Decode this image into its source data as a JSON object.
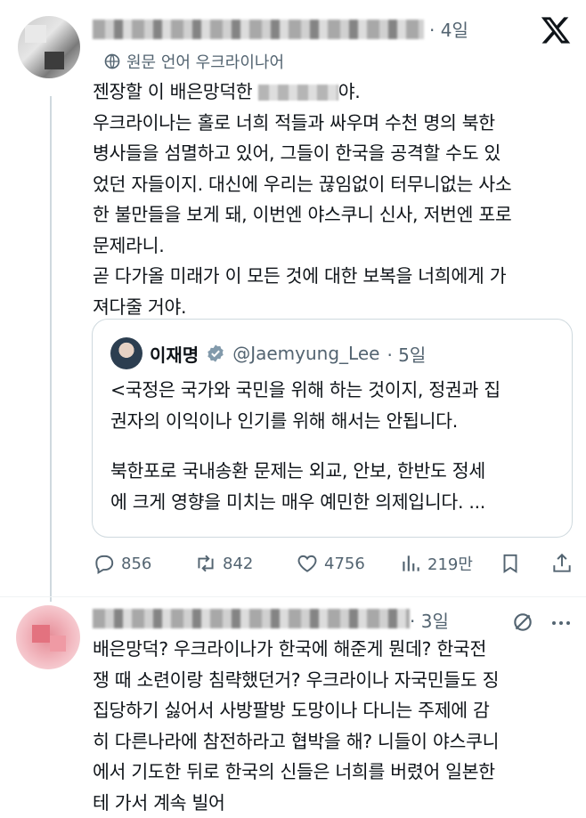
{
  "tweet1": {
    "time": "· 4일",
    "translate_label": "원문 언어 우크라이나어",
    "lines": [
      "젠장할 이 배은망덕한",
      "야.",
      "우크라이나는 홀로 너희 적들과 싸우며 수천 명의 북한",
      "병사들을 섬멸하고 있어, 그들이 한국을 공격할 수도 있",
      "었던 자들이지. 대신에 우리는 끊임없이 터무니없는 사소",
      "한 불만들을 보게 돼, 이번엔 야스쿠니 신사, 저번엔 포로",
      "문제라니.",
      "곧 다가올 미래가 이 모든 것에 대한 보복을 너희에게 가",
      "져다줄 거야."
    ],
    "quote": {
      "name": "이재명",
      "handle": "@Jaemyung_Lee",
      "time": "· 5일",
      "lines": [
        "<국정은 국가와 국민을 위해 하는 것이지, 정권과 집",
        "권자의 이익이나 인기를 위해 해서는 안됩니다.",
        "북한포로 국내송환 문제는 외교, 안보, 한반도 정세",
        "에 크게 영향을 미치는 매우 예민한 의제입니다. ..."
      ]
    },
    "actions": {
      "replies": "856",
      "retweets": "842",
      "likes": "4756",
      "views": "219만"
    }
  },
  "tweet2": {
    "time": "· 3일",
    "lines": [
      "배은망덕? 우크라이나가 한국에 해준게 뭔데? 한국전",
      "쟁 때 소련이랑 침략했던거? 우크라이나 자국민들도 징",
      "집당하기 싫어서 사방팔방 도망이나 다니는 주제에 감",
      "히 다른나라에 참전하라고 협박을 해? 니들이 야스쿠니",
      "에서 기도한 뒤로 한국의 신들은 너희를 버렸어 일본한",
      "테 가서 계속 빌어"
    ]
  },
  "colors": {
    "text": "#0f1419",
    "secondary": "#536471",
    "verified": "#829aab",
    "border": "#cfd9de"
  }
}
